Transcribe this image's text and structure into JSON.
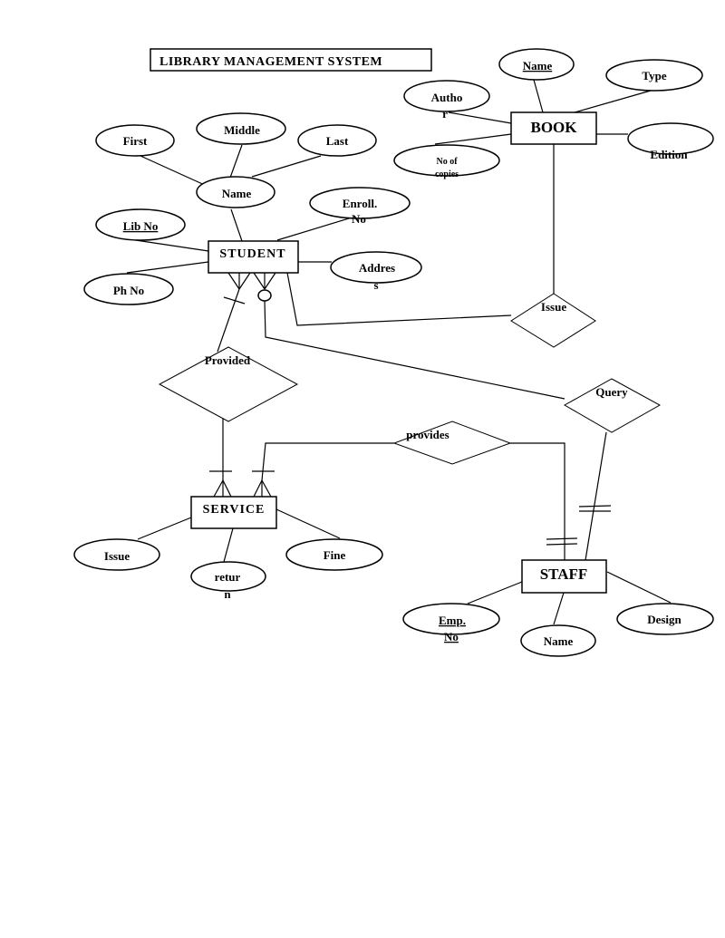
{
  "title": "LIBRARY MANAGEMENT SYSTEM",
  "entities": {
    "book": "BOOK",
    "student": "STUDENT",
    "service": "SERVICE",
    "staff": "STAFF"
  },
  "attributes": {
    "book": {
      "name": "Name",
      "type": "Type",
      "author_line1": "Autho",
      "author_line2": "r",
      "copies_line1": "No of",
      "copies_line2": "copies",
      "edition": "Edition"
    },
    "student": {
      "name": "Name",
      "first": "First",
      "middle": "Middle",
      "last": "Last",
      "lib_no": "Lib No",
      "ph_no": "Ph No",
      "enroll_line1": "Enroll.",
      "enroll_line2": "No",
      "address_line1": "Addres",
      "address_line2": "s"
    },
    "service": {
      "issue": "Issue",
      "return_line1": "retur",
      "return_line2": "n",
      "fine": "Fine"
    },
    "staff": {
      "emp_line1": "Emp.",
      "emp_line2": "No",
      "name": "Name",
      "design": "Design"
    }
  },
  "relationships": {
    "issue": "Issue",
    "provided": "Provided",
    "query": "Query",
    "provides": "provides"
  },
  "key_attributes": [
    "Book.Name",
    "Student.Lib No",
    "Staff.Emp. No"
  ]
}
